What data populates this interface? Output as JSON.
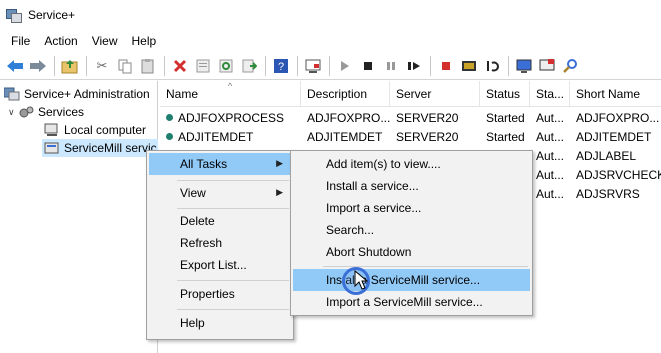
{
  "window": {
    "title": "Service+"
  },
  "menu": [
    "File",
    "Action",
    "View",
    "Help"
  ],
  "toolbar": {
    "icons": [
      "back-icon",
      "forward-icon",
      "up-folder-icon",
      "cut-icon",
      "copy-icon",
      "paste-icon",
      "delete-icon",
      "properties-icon",
      "refresh-icon",
      "export-icon",
      "help-icon",
      "console-icon",
      "play-icon",
      "stop-icon",
      "pause-icon",
      "resume-icon",
      "stop-red-icon",
      "service-icon",
      "restart-icon",
      "computer-icon",
      "monitor-icon",
      "search-icon"
    ]
  },
  "tree": {
    "root": "Service+ Administration",
    "services": "Services",
    "local": "Local computer",
    "servicemill": "ServiceMill servic"
  },
  "list": {
    "headers": [
      "Name",
      "Description",
      "Server",
      "Status",
      "Sta...",
      "Short Name"
    ],
    "rows": [
      {
        "name": "ADJFOXPROCESS",
        "description": "ADJFOXPRO...",
        "server": "SERVER20",
        "status": "Started",
        "startup": "Aut...",
        "short": "ADJFOXPRO..."
      },
      {
        "name": "ADJITEMDET",
        "description": "ADJITEMDET",
        "server": "SERVER20",
        "status": "Started",
        "startup": "Aut...",
        "short": "ADJITEMDET"
      },
      {
        "name": "",
        "description": "",
        "server": "",
        "status": "",
        "startup": "Aut...",
        "short": "ADJLABEL"
      },
      {
        "name": "",
        "description": "",
        "server": "",
        "status": "",
        "startup": "Aut...",
        "short": "ADJSRVCHECK"
      },
      {
        "name": "",
        "description": "",
        "server": "",
        "status": "",
        "startup": "Aut...",
        "short": "ADJSRVRS"
      }
    ]
  },
  "context_menu": {
    "all_tasks": "All Tasks",
    "view": "View",
    "delete": "Delete",
    "refresh": "Refresh",
    "export": "Export List...",
    "properties": "Properties",
    "help": "Help"
  },
  "submenu": {
    "add_items": "Add item(s) to view....",
    "install_service": "Install a service...",
    "import_service": "Import a service...",
    "search": "Search...",
    "abort": "Abort Shutdown",
    "install_servicemill": "Install a ServiceMill service...",
    "import_servicemill": "Import a ServiceMill service..."
  },
  "colors": {
    "highlight": "#91c9f7",
    "status_dot": "#1e7f6e",
    "accent": "#3b6fd8"
  }
}
